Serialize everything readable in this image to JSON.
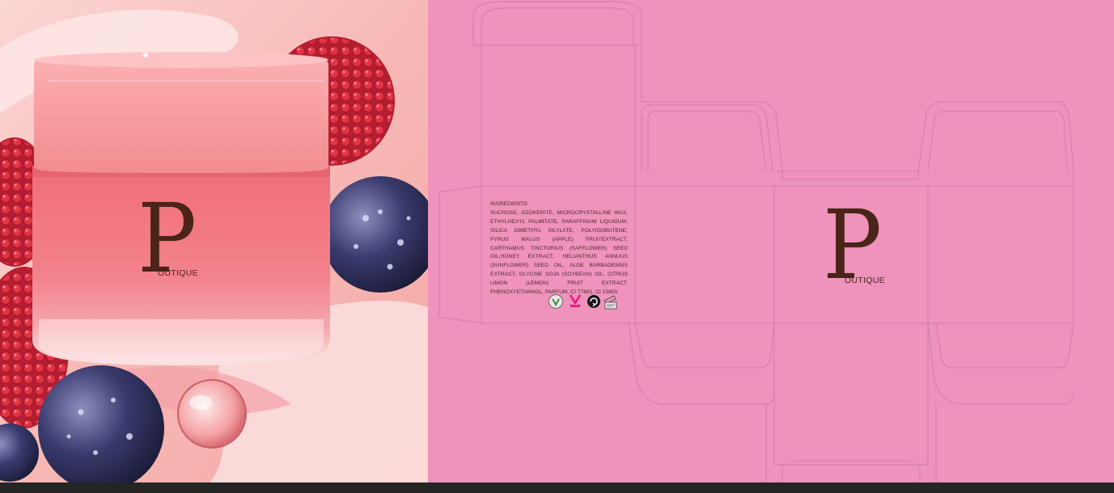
{
  "brand": {
    "letter": "P",
    "suffix": "OUTIQUE"
  },
  "panel": {
    "ingredients_title": "INGREDIENTS:",
    "ingredients_text": "SUCROSE, OZOKERITE, MICROCRYSTALLINE WAX, ETHYLHEXYL PALMITATE, PARAFFINUM LIQUIDUM, SILICA DIMETHYL SILYLATE, POLYISOBUTENE, PYRUS MALUS (APPLE) FRUITEXTRACT, CARTHAMUS TINCTORIUS (SAFFLOWER) SEED OIL,HONEY EXTRACT, HELIANTHUS ANNUUS (SUNFLOWER) SEED OIL, ALOE BARBADENSIS EXTRACT, GLYCINE SOJA (SOYBEAN) OIL, CITRUS LIMON (LEMON) FRUIT EXTRACT, PHENOXYETHANOL, PARFUM, CI 77891, CI 15850",
    "certification_icons": [
      "vegan-icon",
      "cruelty-free-icon",
      "recycle-icon",
      "eco-icon"
    ]
  },
  "colors": {
    "dieline_bg": "#ef92bc",
    "dieline_stroke": "#c97aa5",
    "logo_brown": "#4a2418",
    "jar_pink": "#f07a86"
  }
}
